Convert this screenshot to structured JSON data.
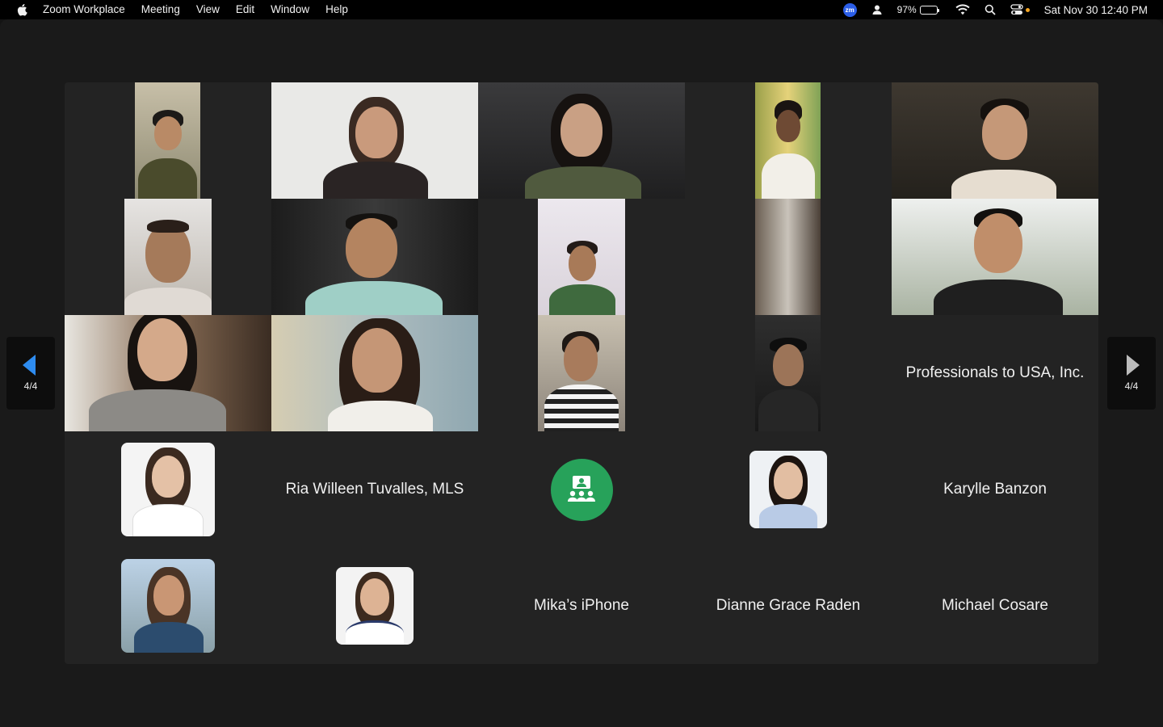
{
  "menubar": {
    "app_name": "Zoom Workplace",
    "menus": [
      "Meeting",
      "View",
      "Edit",
      "Window",
      "Help"
    ],
    "zoom_badge": "zm",
    "battery_percent": "97%",
    "battery_level": 0.97,
    "datetime": "Sat Nov 30  12:40 PM",
    "icons": [
      "apple-icon",
      "zoom-status-icon",
      "user-icon",
      "battery-icon",
      "wifi-icon",
      "spotlight-icon",
      "control-center-icon"
    ]
  },
  "navigation": {
    "prev_page_label": "4/4",
    "next_page_label": "4/4"
  },
  "participants": {
    "name_tiles": [
      "Professionals to USA, Inc.",
      "Ria Willeen Tuvalles, MLS",
      "Karylle Banzon",
      "Mika’s iPhone",
      "Dianne Grace Raden",
      "Michael Cosare"
    ]
  },
  "colors": {
    "accent_blue": "#2e8cf0",
    "group_green": "#27a25a",
    "gallery_bg": "#232323",
    "window_bg": "#1a1a1a"
  }
}
